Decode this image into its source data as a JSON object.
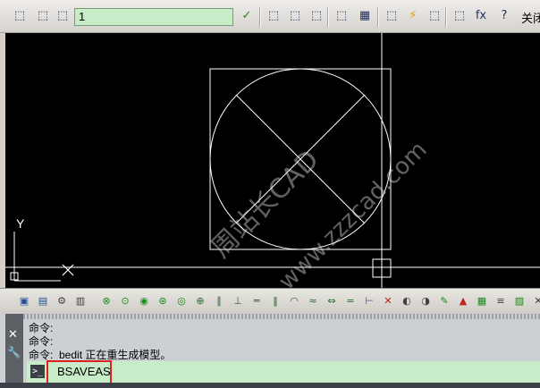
{
  "toolbar": {
    "block_name_value": "1",
    "close_label": "关闭",
    "buttons": [
      {
        "name": "edit-block-icon",
        "glyph": "⬚"
      },
      {
        "name": "save-block-icon",
        "glyph": "⬚"
      },
      {
        "name": "save-block-as-icon",
        "glyph": "⬚"
      },
      {
        "name": "test-block-icon",
        "glyph": "✓"
      },
      {
        "name": "authoring-palettes-icon",
        "glyph": "⬚"
      },
      {
        "name": "parameter-icon",
        "glyph": "⬚"
      },
      {
        "name": "define-attribute-icon",
        "glyph": "⬚"
      },
      {
        "name": "visibility-icon",
        "glyph": "⬚"
      },
      {
        "name": "table-icon",
        "glyph": "▦"
      },
      {
        "name": "constraint-icon",
        "glyph": "⬚"
      },
      {
        "name": "lightning-icon",
        "glyph": "⚡"
      },
      {
        "name": "eraser-icon",
        "glyph": "⬚"
      },
      {
        "name": "manage-icon",
        "glyph": "⬚"
      },
      {
        "name": "fx-icon",
        "glyph": "fx"
      },
      {
        "name": "help-icon",
        "glyph": "?"
      }
    ]
  },
  "canvas": {
    "background": "#000000",
    "line_color": "#ffffff",
    "ucs_y_label": "Y",
    "watermark_line1": "周站长CAD",
    "watermark_line2": "www.zzzcad.com"
  },
  "bottom_toolbar": {
    "buttons": [
      "block-editor-icon",
      "save-icon",
      "properties-icon",
      "layers-icon",
      "constraint-green-icon",
      "geometric-icon",
      "coincident-icon",
      "collinear-icon",
      "concentric-icon",
      "fix-icon",
      "parallel-icon",
      "perpendicular-icon",
      "horizontal-icon",
      "vertical-icon",
      "tangent-icon",
      "smooth-icon",
      "symmetric-icon",
      "equal-icon",
      "dimension-icon",
      "delete-constraints-icon",
      "show-icon",
      "hide-icon",
      "edit-icon",
      "attribute-icon",
      "table-green-icon",
      "linetype-icon",
      "block-table-icon",
      "close-icon"
    ]
  },
  "command_window": {
    "history": [
      "命令:",
      "命令:",
      "命令:  bedit 正在重生成模型。"
    ],
    "current_input": "BSAVEAS",
    "side_close_glyph": "✕",
    "side_tool_glyph": "🔧",
    "prompt_glyph": ">_"
  },
  "colors": {
    "input_green": "#c7ecc7",
    "highlight_red": "#e02020"
  }
}
